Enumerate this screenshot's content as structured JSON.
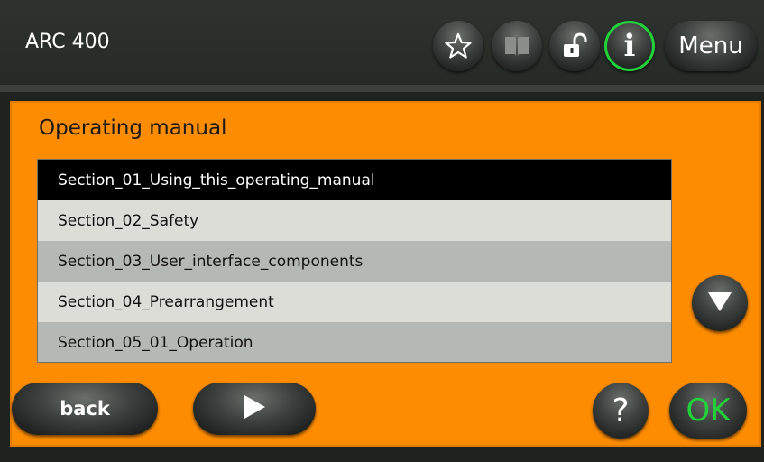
{
  "header": {
    "title": "ARC 400",
    "menu_label": "Menu",
    "icons": [
      "star-icon",
      "book-icon",
      "unlock-icon",
      "info-icon"
    ],
    "info_glyph": "i",
    "info_accent": "#22d13a"
  },
  "panel": {
    "title": "Operating manual",
    "background": "#fd8c00",
    "items": [
      {
        "label": "Section_01_Using_this_operating_manual",
        "selected": true
      },
      {
        "label": "Section_02_Safety",
        "selected": false
      },
      {
        "label": "Section_03_User_interface_components",
        "selected": false
      },
      {
        "label": "Section_04_Prearrangement",
        "selected": false
      },
      {
        "label": "Section_05_01_Operation",
        "selected": false
      }
    ]
  },
  "footer": {
    "back_label": "back",
    "help_label": "?",
    "ok_label": "OK",
    "ok_color": "#22d13a"
  }
}
